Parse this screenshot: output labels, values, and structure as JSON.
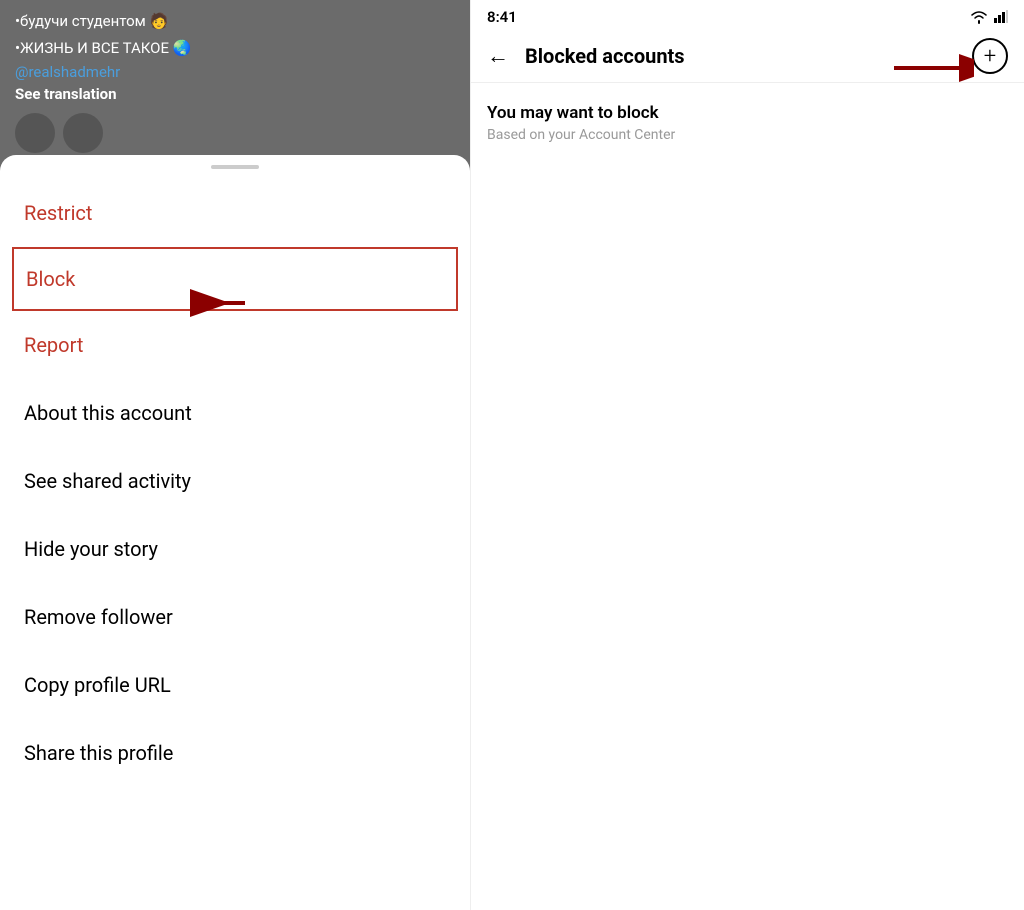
{
  "status_bar": {
    "time": "8:41"
  },
  "right_panel": {
    "title": "Blocked accounts",
    "back_label": "←",
    "add_button_label": "+",
    "section_title": "You may want to block",
    "section_subtitle": "Based on your Account Center"
  },
  "left_panel": {
    "text_lines": [
      "•будучи студентом 🧑",
      "•ЖИЗНЬ И ВСЕ ТАКОЕ 🌏"
    ],
    "link_text": "@realshadmehr",
    "see_translation": "See translation"
  },
  "bottom_sheet": {
    "menu_items": [
      {
        "id": "restrict",
        "label": "Restrict",
        "color": "red"
      },
      {
        "id": "block",
        "label": "Block",
        "color": "red",
        "highlighted": true
      },
      {
        "id": "report",
        "label": "Report",
        "color": "red"
      },
      {
        "id": "about",
        "label": "About this account",
        "color": "black"
      },
      {
        "id": "shared-activity",
        "label": "See shared activity",
        "color": "black"
      },
      {
        "id": "hide-story",
        "label": "Hide your story",
        "color": "black"
      },
      {
        "id": "remove-follower",
        "label": "Remove follower",
        "color": "black"
      },
      {
        "id": "copy-url",
        "label": "Copy profile URL",
        "color": "black"
      },
      {
        "id": "share-profile",
        "label": "Share this profile",
        "color": "black"
      }
    ]
  }
}
